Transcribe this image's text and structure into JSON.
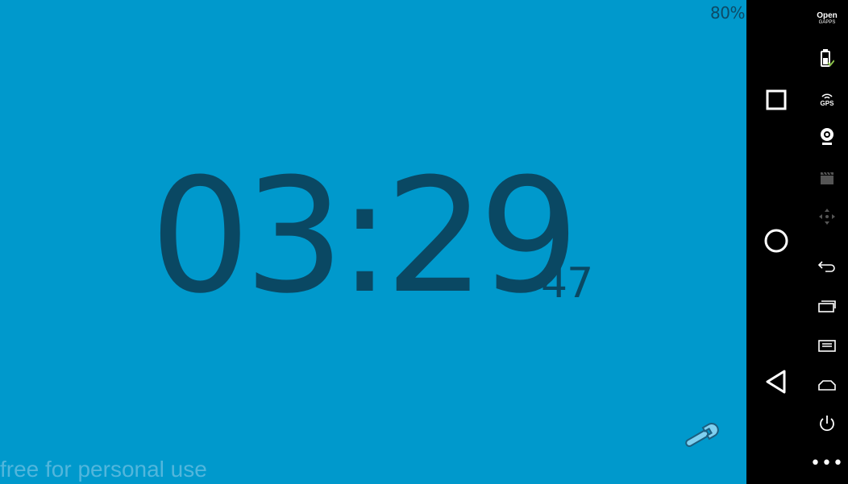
{
  "clock": {
    "battery_percent": "80%",
    "time_main": "03:29",
    "time_seconds": "47",
    "watermark": "free for personal use",
    "background_color": "#0099cc",
    "digit_color": "#0a4863"
  },
  "nav_bar": {
    "buttons": [
      {
        "name": "recents",
        "icon": "square-icon"
      },
      {
        "name": "home",
        "icon": "circle-icon"
      },
      {
        "name": "back",
        "icon": "triangle-back-icon"
      }
    ]
  },
  "emulator_toolbar": {
    "gapps_line1": "Open",
    "gapps_line2": "GAPPS",
    "gps_label": "GPS",
    "more_label": "•••",
    "icons": [
      "battery-icon",
      "gps-icon",
      "webcam-icon",
      "media-icon",
      "dpad-icon",
      "back-icon",
      "recent-apps-icon",
      "menu-icon",
      "home-icon",
      "power-icon"
    ]
  }
}
